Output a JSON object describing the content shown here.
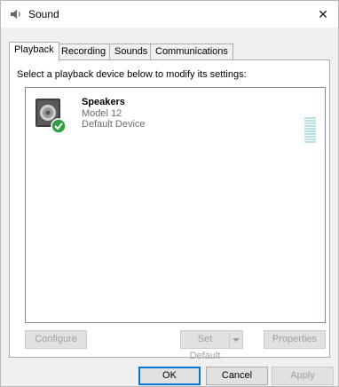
{
  "window": {
    "title": "Sound",
    "close_glyph": "✕",
    "title_icon": "speaker-icon"
  },
  "tabs": [
    {
      "label": "Playback",
      "active": true
    },
    {
      "label": "Recording",
      "active": false
    },
    {
      "label": "Sounds",
      "active": false
    },
    {
      "label": "Communications",
      "active": false
    }
  ],
  "playback": {
    "instruction": "Select a playback device below to modify its settings:",
    "devices": [
      {
        "name": "Speakers",
        "model": "Model 12",
        "status": "Default Device",
        "icon": "speakers-icon",
        "default_badge": "check-icon"
      }
    ],
    "buttons": {
      "configure": "Configure",
      "set_default": "Set Default",
      "properties": "Properties"
    }
  },
  "dialog_buttons": {
    "ok": "OK",
    "cancel": "Cancel",
    "apply": "Apply"
  },
  "colors": {
    "accent": "#0078d7",
    "check_badge": "#2ea043",
    "level_meter": "#b6e4e6"
  }
}
